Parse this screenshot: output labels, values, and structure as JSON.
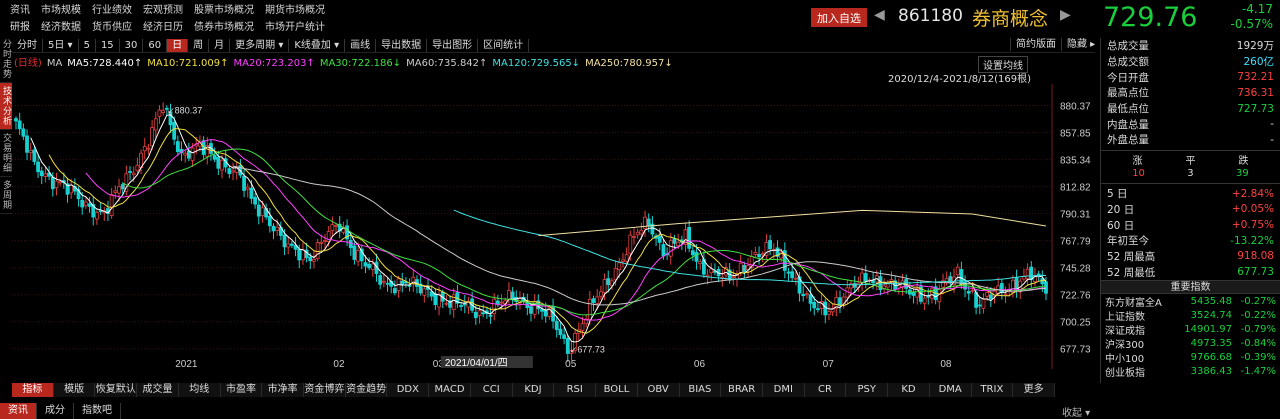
{
  "nav": {
    "row1": [
      "资讯",
      "市场规模",
      "行业绩效",
      "宏观预测",
      "股票市场概况",
      "期货市场概况"
    ],
    "row2": [
      "研报",
      "经济数据",
      "货币供应",
      "经济日历",
      "债券市场概况",
      "市场开户统计"
    ]
  },
  "quote": {
    "add_label": "加入自选",
    "prev": "◀",
    "next": "▶",
    "code": "861180",
    "name": "券商概念",
    "price": "729.76",
    "change": "-4.17",
    "change_pct": "-0.57%"
  },
  "left_tabs": [
    {
      "label": "分时走势",
      "active": false
    },
    {
      "label": "技术分析",
      "active": true
    },
    {
      "label": "交易明细",
      "active": false
    },
    {
      "label": "多周期",
      "active": false
    }
  ],
  "toolbar": {
    "items": [
      {
        "label": "分时",
        "active": false
      },
      {
        "label": "5日 ▾",
        "active": false
      },
      {
        "label": "5",
        "active": false
      },
      {
        "label": "15",
        "active": false
      },
      {
        "label": "30",
        "active": false
      },
      {
        "label": "60",
        "active": false
      },
      {
        "label": "日",
        "active": true
      },
      {
        "label": "周",
        "active": false
      },
      {
        "label": "月",
        "active": false
      },
      {
        "label": "更多周期 ▾",
        "active": false
      },
      {
        "label": "K线叠加 ▾",
        "active": false
      },
      {
        "label": "画线",
        "active": false
      },
      {
        "label": "导出数据",
        "active": false
      },
      {
        "label": "导出图形",
        "active": false
      },
      {
        "label": "区间统计",
        "active": false
      }
    ],
    "right": [
      "简约版面",
      "隐藏 ▸"
    ]
  },
  "ma_legend": [
    {
      "text": "(日线)",
      "color": "#e03030"
    },
    {
      "text": "MA",
      "color": "#cccccc"
    },
    {
      "text": "MA5:728.440↑",
      "color": "#ffffff"
    },
    {
      "text": "MA10:721.009↑",
      "color": "#f0e040"
    },
    {
      "text": "MA20:723.203↑",
      "color": "#ff40ff"
    },
    {
      "text": "MA30:722.186↓",
      "color": "#40e040"
    },
    {
      "text": "MA60:735.842↑",
      "color": "#cccccc"
    },
    {
      "text": "MA120:729.565↓",
      "color": "#40e0e0"
    },
    {
      "text": "MA250:780.957↓",
      "color": "#f0e0a0"
    }
  ],
  "set_ma_label": "设置均线",
  "range_label": "2020/12/4-2021/8/12(169根)",
  "chart_data": {
    "type": "line",
    "ylim": [
      670,
      895
    ],
    "y_ticks": [
      880.37,
      857.85,
      835.34,
      812.82,
      790.31,
      767.79,
      745.28,
      722.76,
      700.25,
      677.73
    ],
    "x_labels": [
      "2021",
      "02",
      "03",
      "05",
      "06",
      "07",
      "08"
    ],
    "cursor_date": "2021/04/01/四",
    "high_annotation": "880.37",
    "low_annotation": "677.73",
    "colors": {
      "up": "#e04040",
      "down": "#19d0d0",
      "ma5": "#ffffff",
      "ma10": "#f0e040",
      "ma20": "#ff40ff",
      "ma30": "#40e040",
      "ma60": "#cccccc",
      "ma120": "#40e0e0",
      "ma250": "#f0e0a0"
    },
    "anchors": [
      [
        0,
        865
      ],
      [
        5,
        830
      ],
      [
        12,
        815
      ],
      [
        18,
        800
      ],
      [
        24,
        790
      ],
      [
        30,
        820
      ],
      [
        36,
        850
      ],
      [
        40,
        880
      ],
      [
        45,
        840
      ],
      [
        50,
        845
      ],
      [
        55,
        835
      ],
      [
        60,
        825
      ],
      [
        64,
        800
      ],
      [
        68,
        790
      ],
      [
        74,
        760
      ],
      [
        80,
        755
      ],
      [
        84,
        770
      ],
      [
        88,
        780
      ],
      [
        92,
        760
      ],
      [
        96,
        745
      ],
      [
        100,
        730
      ],
      [
        106,
        735
      ],
      [
        110,
        725
      ],
      [
        116,
        720
      ],
      [
        122,
        712
      ],
      [
        126,
        708
      ],
      [
        131,
        715
      ],
      [
        136,
        720
      ],
      [
        142,
        712
      ],
      [
        146,
        700
      ],
      [
        150,
        678
      ],
      [
        154,
        700
      ],
      [
        158,
        720
      ],
      [
        163,
        745
      ],
      [
        168,
        770
      ],
      [
        172,
        783
      ],
      [
        176,
        760
      ],
      [
        182,
        768
      ],
      [
        186,
        748
      ],
      [
        190,
        740
      ],
      [
        194,
        735
      ],
      [
        200,
        755
      ],
      [
        206,
        760
      ],
      [
        210,
        745
      ],
      [
        216,
        712
      ],
      [
        220,
        710
      ],
      [
        226,
        725
      ],
      [
        232,
        738
      ],
      [
        238,
        730
      ],
      [
        244,
        725
      ],
      [
        250,
        722
      ],
      [
        256,
        742
      ],
      [
        262,
        712
      ],
      [
        266,
        725
      ],
      [
        270,
        730
      ],
      [
        276,
        738
      ],
      [
        280,
        729.76
      ]
    ],
    "ma250": [
      [
        142,
        772
      ],
      [
        180,
        782
      ],
      [
        230,
        793
      ],
      [
        260,
        790
      ],
      [
        280,
        780
      ]
    ]
  },
  "right_panel": {
    "stats": [
      {
        "label": "总成交量",
        "value": "1929万",
        "color": "#dddddd"
      },
      {
        "label": "总成交额",
        "value": "260亿",
        "color": "#40e0ff"
      },
      {
        "label": "今日开盘",
        "value": "732.21",
        "color": "#ff4040"
      },
      {
        "label": "最高点位",
        "value": "736.31",
        "color": "#ff4040"
      },
      {
        "label": "最低点位",
        "value": "727.73",
        "color": "#19d03c"
      },
      {
        "label": "内盘总量",
        "value": "-",
        "color": "#dddddd"
      },
      {
        "label": "外盘总量",
        "value": "-",
        "color": "#dddddd"
      }
    ],
    "zpd_labels": [
      "涨",
      "平",
      "跌"
    ],
    "zpd_values": [
      {
        "v": "10",
        "c": "#ff4040"
      },
      {
        "v": "3",
        "c": "#dddddd"
      },
      {
        "v": "39",
        "c": "#19d03c"
      }
    ],
    "periods": [
      {
        "label": "5 日",
        "value": "+2.84%",
        "color": "#ff4040"
      },
      {
        "label": "20 日",
        "value": "+0.05%",
        "color": "#ff4040"
      },
      {
        "label": "60 日",
        "value": "+0.75%",
        "color": "#ff4040"
      },
      {
        "label": "年初至今",
        "value": "-13.22%",
        "color": "#19d03c"
      },
      {
        "label": "52 周最高",
        "value": "918.08",
        "color": "#ff4040"
      },
      {
        "label": "52 周最低",
        "value": "677.73",
        "color": "#19d03c"
      }
    ],
    "index_title": "重要指数",
    "indices": [
      {
        "name": "东方财富全A",
        "value": "5435.48",
        "pct": "-0.27%"
      },
      {
        "name": "上证指数",
        "value": "3524.74",
        "pct": "-0.22%"
      },
      {
        "name": "深证成指",
        "value": "14901.97",
        "pct": "-0.79%"
      },
      {
        "name": "沪深300",
        "value": "4973.35",
        "pct": "-0.84%"
      },
      {
        "name": "中小100",
        "value": "9766.68",
        "pct": "-0.39%"
      },
      {
        "name": "创业板指",
        "value": "3386.43",
        "pct": "-1.47%"
      }
    ]
  },
  "indicator_tabs": [
    {
      "label": "指标",
      "active": true
    },
    {
      "label": "模版",
      "active": false
    },
    {
      "label": "恢复默认",
      "active": false
    },
    {
      "label": "成交量",
      "active": false
    },
    {
      "label": "均线",
      "active": false
    },
    {
      "label": "市盈率",
      "active": false
    },
    {
      "label": "市净率",
      "active": false
    },
    {
      "label": "资金博弈",
      "active": false
    },
    {
      "label": "资金趋势",
      "active": false
    },
    {
      "label": "DDX",
      "active": false
    },
    {
      "label": "MACD",
      "active": false
    },
    {
      "label": "CCI",
      "active": false
    },
    {
      "label": "KDJ",
      "active": false
    },
    {
      "label": "RSI",
      "active": false
    },
    {
      "label": "BOLL",
      "active": false
    },
    {
      "label": "OBV",
      "active": false
    },
    {
      "label": "BIAS",
      "active": false
    },
    {
      "label": "BRAR",
      "active": false
    },
    {
      "label": "DMI",
      "active": false
    },
    {
      "label": "CR",
      "active": false
    },
    {
      "label": "PSY",
      "active": false
    },
    {
      "label": "KD",
      "active": false
    },
    {
      "label": "DMA",
      "active": false
    },
    {
      "label": "TRIX",
      "active": false
    },
    {
      "label": "更多",
      "active": false
    }
  ],
  "bottom_tabs": [
    {
      "label": "资讯",
      "active": true
    },
    {
      "label": "成分",
      "active": false
    },
    {
      "label": "指数吧",
      "active": false
    }
  ],
  "collapse_label": "收起 ▾"
}
